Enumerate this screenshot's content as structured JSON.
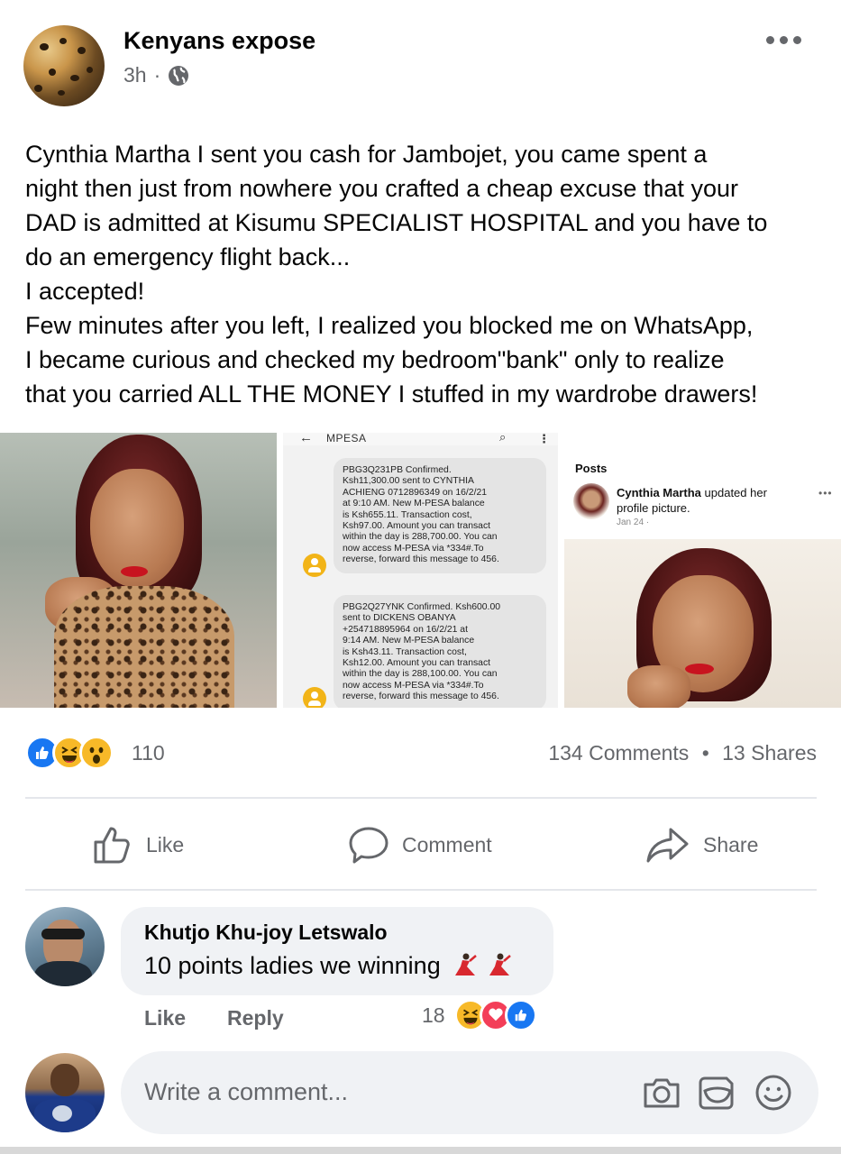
{
  "post": {
    "page_name": "Kenyans expose",
    "time": "3h",
    "separator": "·",
    "text_lines": [
      "Cynthia Martha  I sent you cash for Jambojet, you came spent a",
      "night then just from nowhere you crafted a cheap excuse that your",
      "DAD is admitted at Kisumu SPECIALIST HOSPITAL and you have to",
      "do an emergency flight back...",
      "I accepted!",
      "Few minutes after you left, I realized you blocked me on WhatsApp,",
      "I became curious and checked my bedroom\"bank\" only to realize",
      "that you carried ALL THE MONEY I stuffed in my wardrobe drawers!"
    ]
  },
  "sms_screenshot": {
    "title": "MPESA",
    "messages": [
      {
        "lines": [
          "PBG3Q231PB Confirmed.",
          "Ksh11,300.00 sent to CYNTHIA",
          "ACHIENG 0712896349 on 16/2/21",
          "at 9:10 AM. New M-PESA balance",
          "is Ksh655.11. Transaction cost,",
          "Ksh97.00. Amount you can transact",
          "within the day is 288,700.00. You can",
          "now access M-PESA via *334#.To",
          "reverse, forward this message to 456."
        ]
      },
      {
        "lines": [
          "PBG2Q27YNK Confirmed. Ksh600.00",
          "sent to DICKENS  OBANYA",
          "+254718895964 on 16/2/21 at",
          "9:14 AM. New M-PESA balance",
          "is Ksh43.11. Transaction cost,",
          "Ksh12.00. Amount you can transact",
          "within the day is 288,100.00. You can",
          "now access M-PESA via *334#.To",
          "reverse, forward this message to 456."
        ]
      }
    ]
  },
  "fb_card": {
    "section_title": "Posts",
    "author": "Cynthia Martha",
    "action_text": " updated her profile picture.",
    "date": "Jan 24 ·",
    "more": "•••"
  },
  "stats": {
    "reaction_count": "110",
    "comments": "134 Comments",
    "separator": "•",
    "shares": "13 Shares"
  },
  "actions": {
    "like": "Like",
    "comment": "Comment",
    "share": "Share"
  },
  "comment": {
    "author": "Khutjo Khu-joy Letswalo",
    "text": "10 points ladies we winning",
    "like": "Like",
    "reply": "Reply",
    "reaction_count": "18"
  },
  "composer": {
    "placeholder": "Write a comment..."
  },
  "colors": {
    "facebook_blue": "#1877f2",
    "secondary_text": "#65676b",
    "bubble_bg": "#f0f2f5",
    "love_red": "#f33e58",
    "haha_yellow": "#f7b928"
  },
  "icons": [
    "globe-icon",
    "more-icon",
    "like-icon",
    "comment-icon",
    "share-icon",
    "camera-icon",
    "gif-icon",
    "emoji-icon",
    "dancer-emoji"
  ]
}
